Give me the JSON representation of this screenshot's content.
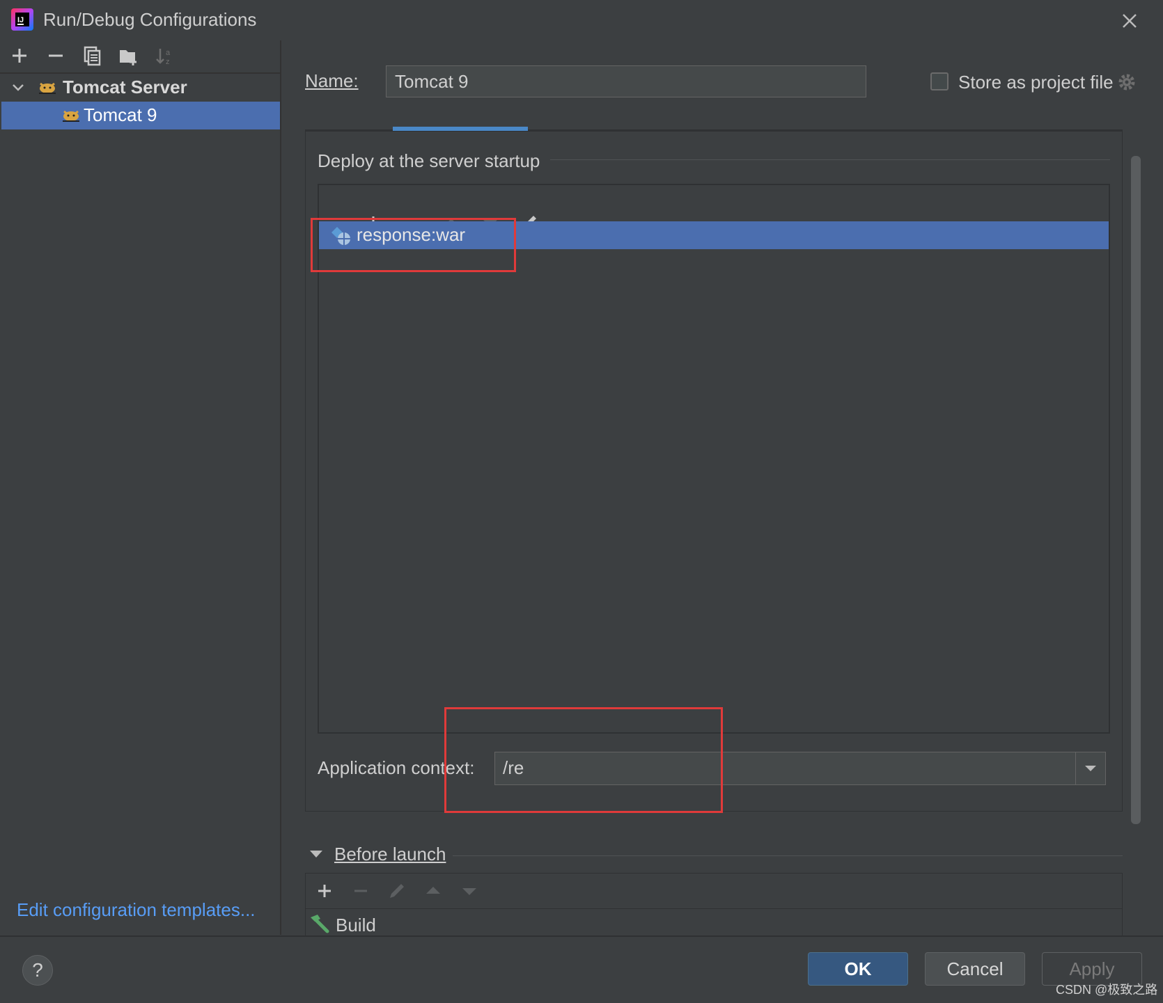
{
  "window": {
    "title": "Run/Debug Configurations"
  },
  "tree": {
    "group_label": "Tomcat Server",
    "child_label": "Tomcat 9"
  },
  "left_footer": {
    "edit_templates": "Edit configuration templates..."
  },
  "form": {
    "name_label": "Name:",
    "name_value": "Tomcat 9",
    "store_label": "Store as project file"
  },
  "deploy": {
    "section_title": "Deploy at the server startup",
    "artifacts": [
      "response:war"
    ],
    "context_label": "Application context:",
    "context_value": "/re"
  },
  "before_launch": {
    "title": "Before launch",
    "tasks": [
      "Build"
    ]
  },
  "buttons": {
    "help": "?",
    "ok": "OK",
    "cancel": "Cancel",
    "apply": "Apply"
  },
  "watermark": "CSDN @极致之路",
  "colors": {
    "selection": "#4b6eaf",
    "tab_accent": "#4a88c7",
    "link": "#589df6",
    "highlight_box": "#e03a3a"
  }
}
